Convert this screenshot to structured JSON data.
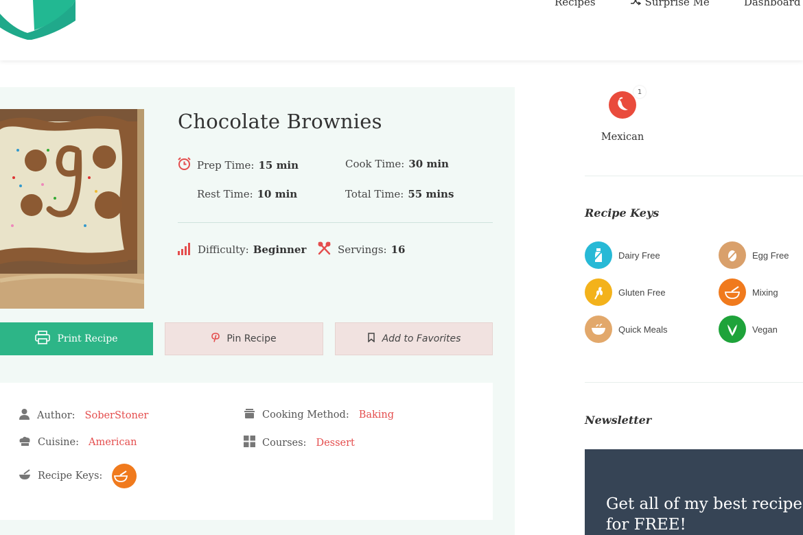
{
  "nav": {
    "items": [
      {
        "label": "Recipes",
        "icon": "none"
      },
      {
        "label": "Surprise Me",
        "icon": "shuffle-icon"
      },
      {
        "label": "Dashboard",
        "icon": "none"
      }
    ]
  },
  "recipe": {
    "title": "Chocolate Brownies",
    "prep_label": "Prep Time:",
    "prep_value": "15 min",
    "cook_label": "Cook Time:",
    "cook_value": "30 min",
    "rest_label": "Rest Time:",
    "rest_value": "10 min",
    "total_label": "Total Time:",
    "total_value": "55 mins",
    "difficulty_label": "Difficulty:",
    "difficulty_value": "Beginner",
    "servings_label": "Servings:",
    "servings_value": "16"
  },
  "buttons": {
    "print": "Print Recipe",
    "pin": "Pin Recipe",
    "favorites": "Add to Favorites"
  },
  "details": {
    "author_label": "Author:",
    "author_value": "SoberStoner",
    "method_label": "Cooking Method:",
    "method_value": "Baking",
    "cuisine_label": "Cuisine:",
    "cuisine_value": "American",
    "courses_label": "Courses:",
    "courses_value": "Dessert",
    "keys_label": "Recipe Keys:"
  },
  "sidebar": {
    "category": {
      "label": "Mexican",
      "count": "1"
    },
    "recipe_keys_heading": "Recipe Keys",
    "keys": [
      {
        "label": "Dairy Free",
        "color": "#27b9d6"
      },
      {
        "label": "Egg Free",
        "color": "#d9a06b"
      },
      {
        "label": "Gluten Free",
        "color": "#f3b21b"
      },
      {
        "label": "Mixing",
        "color": "#f07a1d"
      },
      {
        "label": "Quick Meals",
        "color": "#e2a86b"
      },
      {
        "label": "Vegan",
        "color": "#1ea33a"
      }
    ],
    "newsletter_heading": "Newsletter",
    "newsletter_line1": "Get all of my best recipes",
    "newsletter_line2": "for FREE!"
  },
  "colors": {
    "accent_green": "#2db587",
    "link_red": "#e44d4d",
    "card_bg": "#f2f9f6",
    "newsletter_bg": "#364455"
  }
}
